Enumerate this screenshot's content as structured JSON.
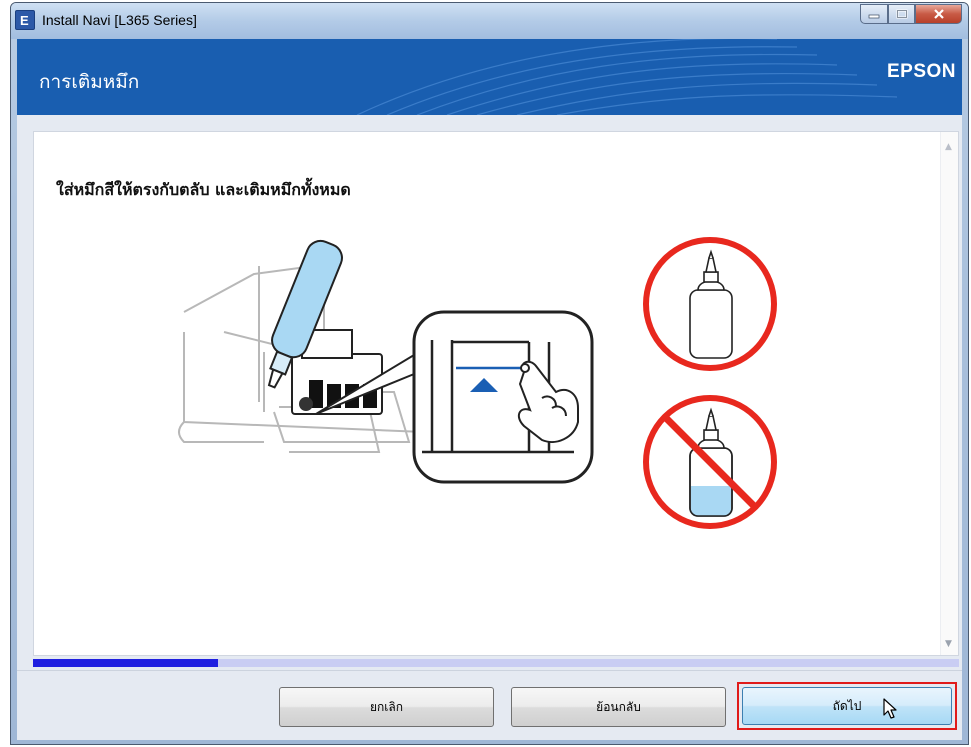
{
  "window": {
    "title": "Install Navi [L365 Series]",
    "icon_letter": "E"
  },
  "header": {
    "title": "การเติมหมึก",
    "brand": "EPSON"
  },
  "content": {
    "instruction": "ใส่หมึกสีให้ตรงกับตลับ และเติมหมึกทั้งหมด",
    "illustration_icons": [
      "ink-bottle-pour-icon",
      "ink-level-zoom-icon",
      "full-bottle-ok-icon",
      "partial-bottle-prohibited-icon"
    ]
  },
  "progress": {
    "value": 0.2
  },
  "buttons": {
    "cancel": "ยกเลิก",
    "back": "ย้อนกลับ",
    "next": "ถัดไป"
  },
  "colors": {
    "header_bg": "#195eb0",
    "progress_fill": "#1f1fe0",
    "progress_track": "#c9cdf3",
    "highlight_frame": "#e01b1b",
    "ink_blue": "#a9d8f3"
  }
}
